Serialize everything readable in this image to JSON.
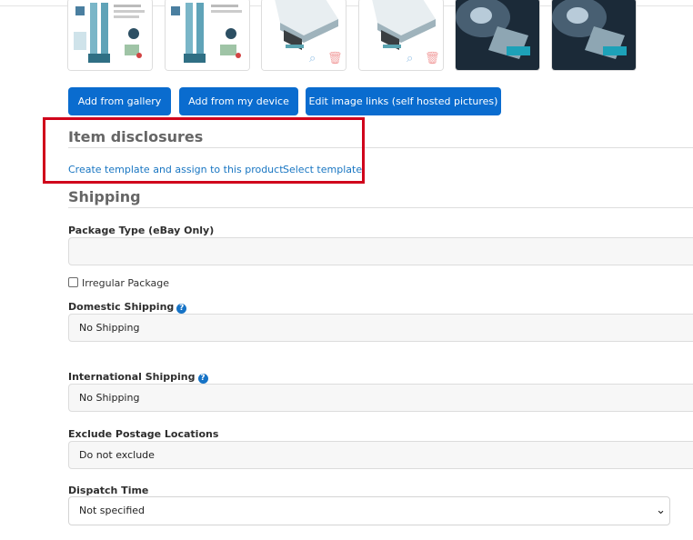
{
  "gallery": {
    "buttons": {
      "add_from_gallery": "Add from gallery",
      "add_from_device": "Add from my device",
      "edit_image_links": "Edit image links (self hosted pictures)"
    },
    "thumbnail_icons": [
      "zoom-icon",
      "trash-icon"
    ]
  },
  "disclosures": {
    "title": "Item disclosures",
    "create_template_link": "Create template and assign to this product",
    "select_template_link": "Select template"
  },
  "shipping": {
    "title": "Shipping",
    "package_type_label": "Package Type (eBay Only)",
    "package_type_value": "",
    "irregular_package_label": "Irregular Package",
    "irregular_package_checked": false,
    "domestic_label": "Domestic Shipping",
    "domestic_value": "No Shipping",
    "international_label": "International Shipping",
    "international_value": "No Shipping",
    "exclude_label": "Exclude Postage Locations",
    "exclude_value": "Do not exclude",
    "dispatch_label": "Dispatch Time",
    "dispatch_value": "Not specified",
    "help_glyph": "?"
  },
  "colors": {
    "primary_button": "#0a6ccf",
    "link": "#1976c2",
    "highlight_border": "#d0021b",
    "help_icon": "#1673c6"
  }
}
